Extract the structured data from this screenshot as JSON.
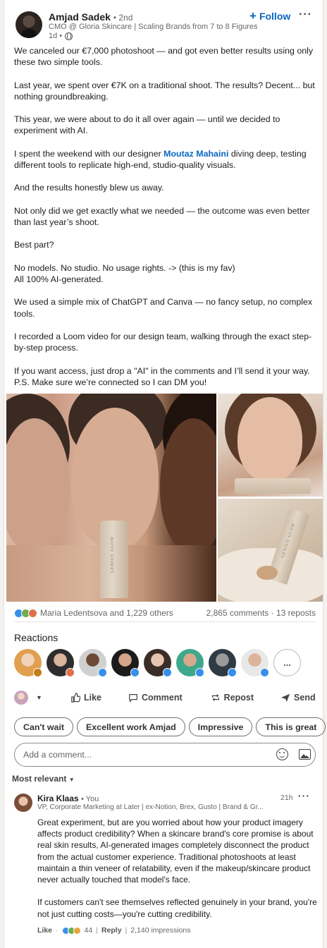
{
  "author": {
    "name": "Amjad Sadek",
    "degree": "• 2nd",
    "headline": "CMO @ Gloria Skincare | Scaling Brands from 7 to 8 Figures",
    "time": "1d •",
    "follow_label": "Follow"
  },
  "post": {
    "p1": "We canceled our €7,000 photoshoot — and got even better results using only these two simple tools.",
    "p2": "Last year, we spent over €7K on a traditional shoot. The results? Decent... but nothing groundbreaking.",
    "p3": "This year, we were about to do it all over again — until we decided to experiment with AI.",
    "p4_before": "I spent the weekend with our designer ",
    "p4_mention": "Moutaz Mahaini",
    "p4_after": " diving deep, testing different tools to replicate high-end, studio-quality visuals.",
    "p5": "And the results honestly blew us away.",
    "p6": "Not only did we get exactly what we needed — the outcome was even better than last year’s shoot.",
    "p7": "Best part?",
    "p8_line1": "No models. No studio. No usage rights. -> (this is my fav)",
    "p8_line2": "All 100% AI-generated.",
    "p9": "We used a simple mix of ChatGPT and Canva — no fancy setup, no complex tools.",
    "p10": "I recorded a Loom video for our design team, walking through the exact step-by-step process.",
    "p11_line1": "If you want access, just drop a \"AI\" in the comments and I’ll send it your way.",
    "p11_line2": "P.S. Make sure we’re connected so I can DM you!",
    "tube_label": "GENIUS GLOW"
  },
  "social": {
    "reactors_text": "Maria Ledentsova and 1,229 others",
    "stats_text": "2,865 comments · 13 reposts"
  },
  "reactions": {
    "title": "Reactions",
    "more": "..."
  },
  "actions": {
    "like": "Like",
    "comment": "Comment",
    "repost": "Repost",
    "send": "Send"
  },
  "chips": [
    "Can't wait",
    "Excellent work Amjad",
    "Impressive",
    "This is great"
  ],
  "comment_box": {
    "placeholder": "Add a comment..."
  },
  "sort": {
    "label": "Most relevant"
  },
  "comment": {
    "name": "Kira Klaas",
    "you": "• You",
    "headline": "VP, Corporate Marketing at Later | ex-Notion, Brex, Gusto | Brand & Gr...",
    "time": "21h",
    "p1": "Great experiment, but are you worried about how your product imagery affects product credibility? When a skincare brand's core promise is about real skin results, AI-generated images completely disconnect the product from the actual customer experience. Traditional photoshoots at least maintain a thin veneer of relatability, even if the makeup/skincare product never actually touched that model's face.",
    "p2": "If customers can't see themselves reflected genuinely in your brand, you're not just cutting costs—you're cutting credibility.",
    "like": "Like",
    "like_count": "44",
    "reply": "Reply",
    "impressions": "2,140 impressions"
  },
  "colors": {
    "link_blue": "#0a66c2",
    "like_blue": "#378fe9",
    "celebrate_green": "#44712e",
    "love_red": "#df704d"
  }
}
